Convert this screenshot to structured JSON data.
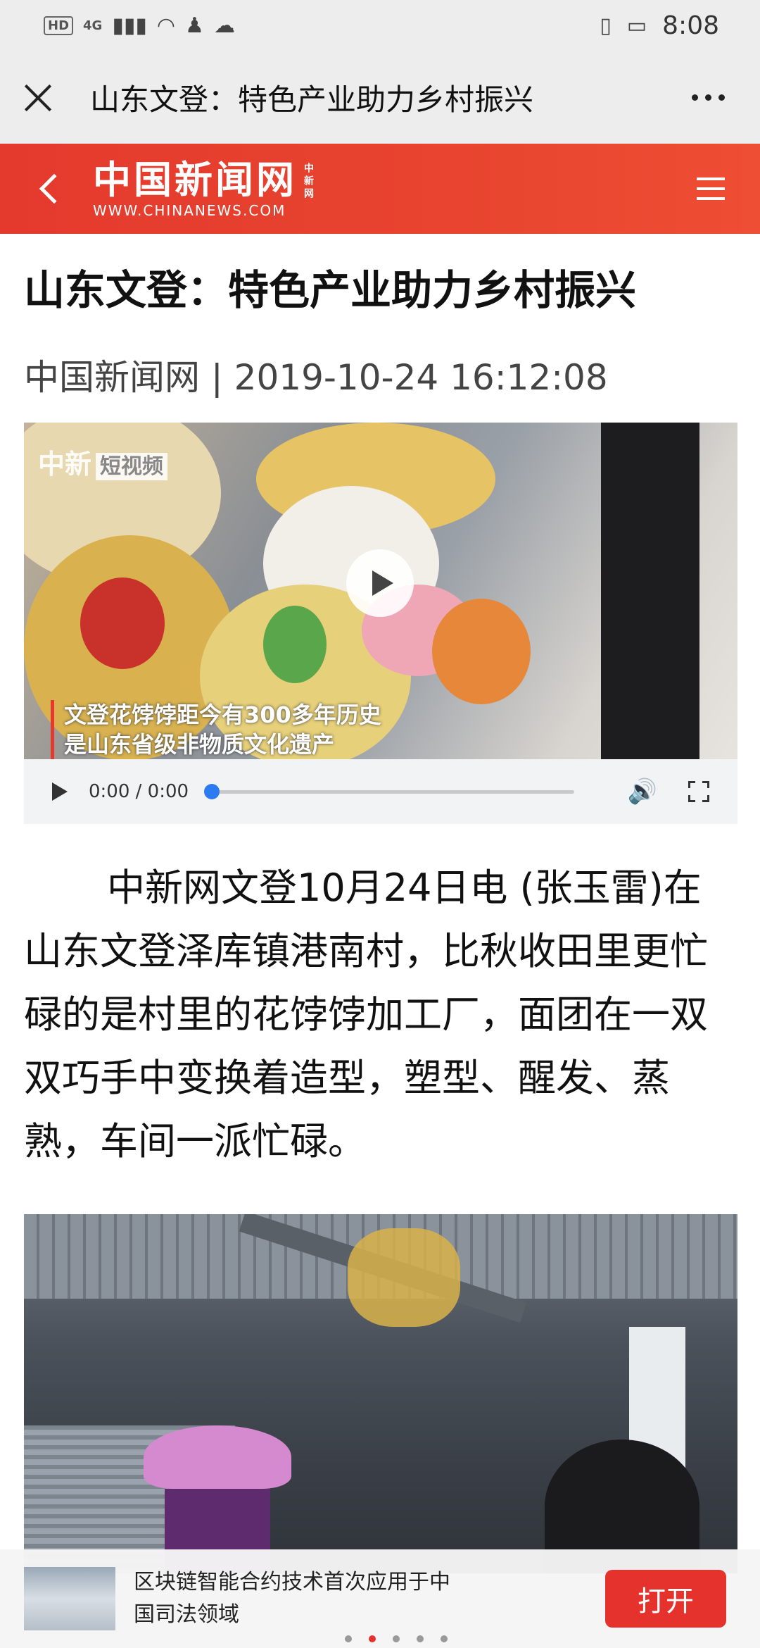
{
  "status_bar": {
    "network": "4G",
    "hd": "HD",
    "time": "8:08"
  },
  "title_bar": {
    "title": "山东文登：特色产业助力乡村振兴"
  },
  "site_header": {
    "logo_cn": "中国新闻网",
    "logo_small": "中新网",
    "logo_en": "WWW.CHINANEWS.COM"
  },
  "article": {
    "title": "山东文登：特色产业助力乡村振兴",
    "meta": "中国新闻网 | 2019-10-24 16:12:08",
    "video": {
      "watermark_main": "中新",
      "watermark_tag": "短视频",
      "caption_line1": "文登花饽饽距今有300多年历史",
      "caption_line2": "是山东省级非物质文化遗产",
      "time_display": "0:00 / 0:00"
    },
    "body": "中新网文登10月24日电 (张玉雷)在山东文登泽库镇港南村，比秋收田里更忙碌的是村里的花饽饽加工厂，面团在一双双巧手中变换着造型，塑型、醒发、蒸熟，车间一派忙碌。"
  },
  "banner": {
    "text": "区块链智能合约技术首次应用于中国司法领域",
    "open_label": "打开",
    "page_count": 5,
    "active_page": 2
  },
  "colors": {
    "brand_red": "#e43a2e",
    "button_red": "#e5322d",
    "progress_blue": "#2d7bf0"
  }
}
